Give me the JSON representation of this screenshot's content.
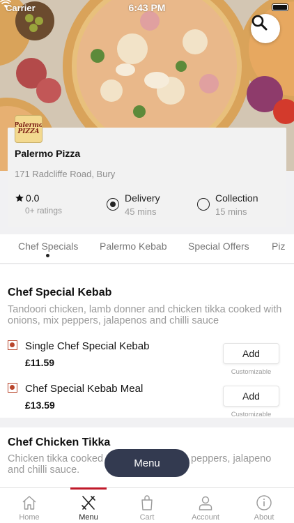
{
  "status_bar": {
    "carrier": "Carrier",
    "time": "6:43 PM"
  },
  "hero": {
    "search_icon": "search-icon"
  },
  "restaurant": {
    "logo_text": "Palermo PIZZA",
    "name": "Palermo Pizza",
    "address": "171 Radcliffe Road, Bury",
    "rating": "0.0",
    "rating_count": "0+ ratings"
  },
  "fulfilment": [
    {
      "label": "Delivery",
      "time": "45 mins",
      "selected": true
    },
    {
      "label": "Collection",
      "time": "15 mins",
      "selected": false
    }
  ],
  "tabs": [
    "Chef Specials",
    "Palermo Kebab",
    "Special Offers",
    "Piz"
  ],
  "active_tab": "Chef Specials",
  "sections": [
    {
      "title": "Chef Special Kebab",
      "description": "Tandoori chicken, lamb donner and chicken tikka cooked with onions, mix peppers, jalapenos and chilli sauce",
      "items": [
        {
          "name": "Single Chef Special Kebab",
          "price": "£11.59",
          "button": "Add",
          "note": "Customizable"
        },
        {
          "name": "Chef Special Kebab Meal",
          "price": "£13.59",
          "button": "Add",
          "note": "Customizable"
        }
      ]
    },
    {
      "title": "Chef Chicken Tikka",
      "description_left": "Chicken tikka cooked",
      "description_right": "peppers, jalapeno",
      "description_line2": "and chilli sauce."
    }
  ],
  "floating_menu": "Menu",
  "bottom_nav": [
    {
      "label": "Home",
      "icon": "home-icon"
    },
    {
      "label": "Menu",
      "icon": "fork-knife-icon",
      "active": true
    },
    {
      "label": "Cart",
      "icon": "shopping-bag-icon"
    },
    {
      "label": "Account",
      "icon": "user-icon"
    },
    {
      "label": "About",
      "icon": "info-icon"
    }
  ],
  "colors": {
    "accent": "#c01a2a",
    "menu_pill": "#333a50",
    "veg_mark": "#b8452b"
  }
}
